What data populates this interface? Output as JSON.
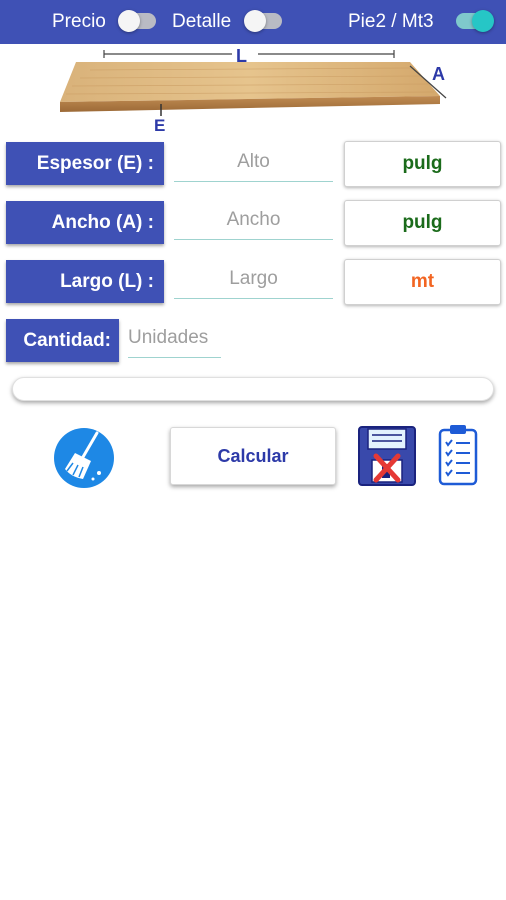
{
  "header": {
    "toggles": [
      {
        "label": "Precio",
        "state": "off"
      },
      {
        "label": "Detalle",
        "state": "off"
      },
      {
        "label": "Pie2 / Mt3",
        "state": "on"
      }
    ]
  },
  "diagram": {
    "length_label": "L",
    "width_label": "A",
    "thickness_label": "E"
  },
  "form": {
    "rows": [
      {
        "label": "Espesor (E) :",
        "placeholder": "Alto",
        "unit": "pulg",
        "unit_color": "#1b6b1b"
      },
      {
        "label": "Ancho (A) :",
        "placeholder": "Ancho",
        "unit": "pulg",
        "unit_color": "#1b6b1b"
      },
      {
        "label": "Largo (L) :",
        "placeholder": "Largo",
        "unit": "mt",
        "unit_color": "#f26522"
      }
    ],
    "quantity": {
      "label": "Cantidad:",
      "placeholder": "Unidades"
    }
  },
  "actions": {
    "calculate_label": "Calcular",
    "clear_icon": "broom-icon",
    "delete_save_icon": "floppy-delete-icon",
    "list_icon": "clipboard-checklist-icon"
  },
  "colors": {
    "primary": "#3f51b5",
    "toggle_on": "#26c6c6",
    "input_underline": "#9fd3cf"
  }
}
